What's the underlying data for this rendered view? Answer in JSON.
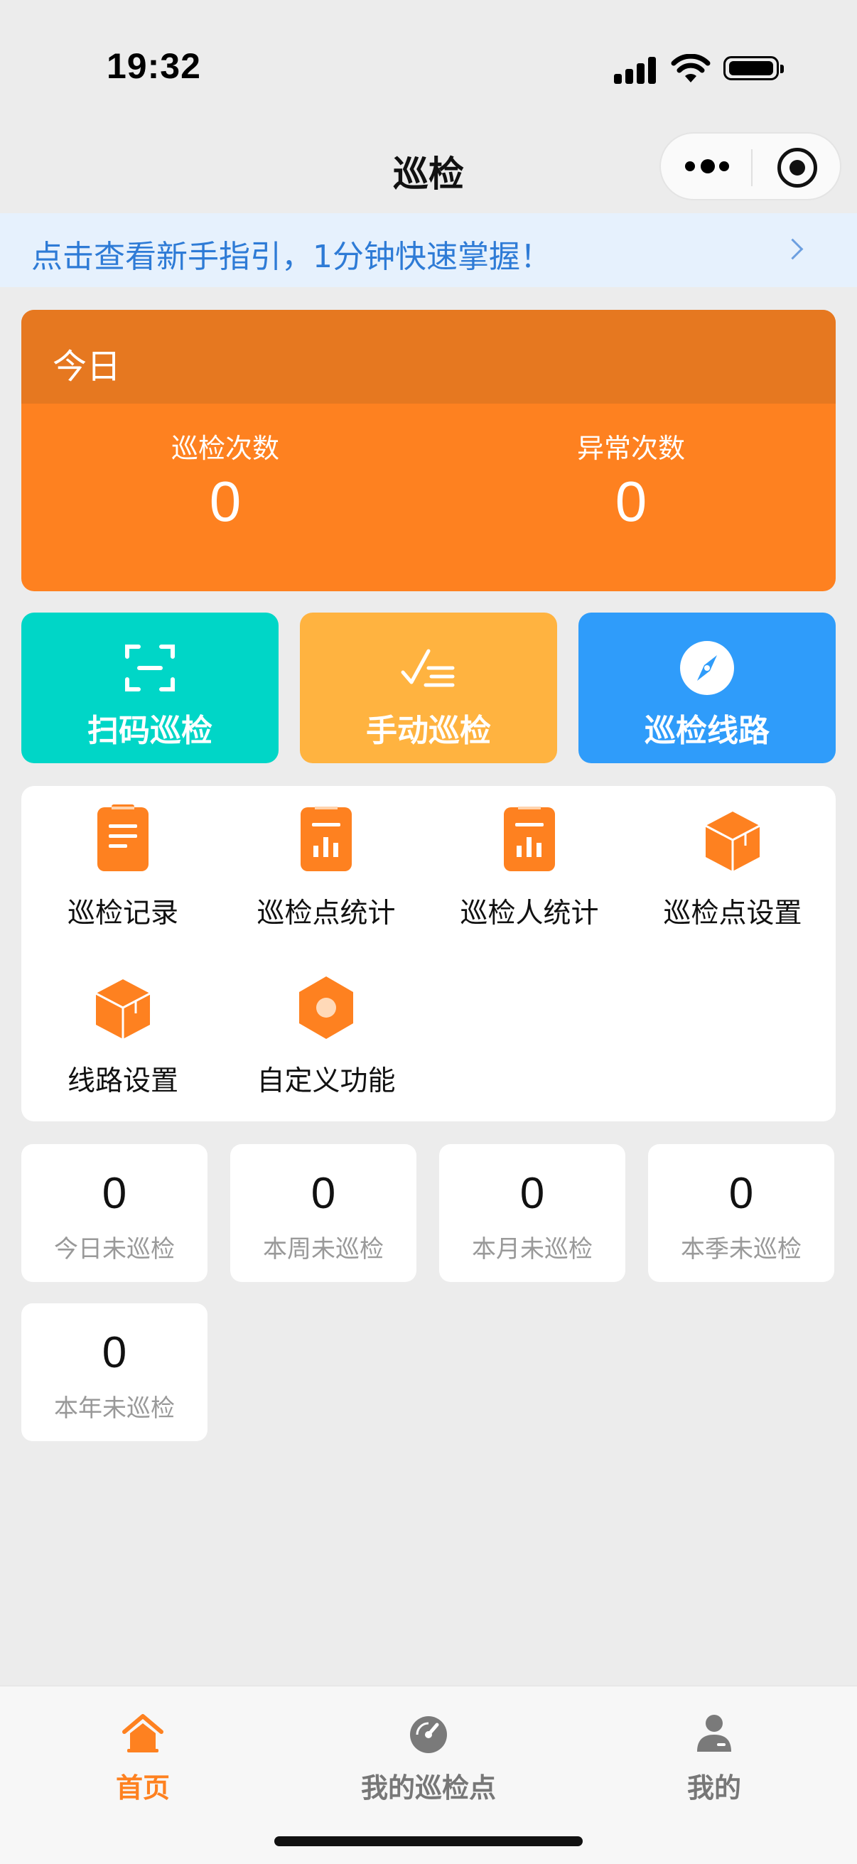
{
  "status_bar": {
    "time": "19:32"
  },
  "nav": {
    "title": "巡检"
  },
  "guide": {
    "text": "点击查看新手指引，1分钟快速掌握！"
  },
  "today": {
    "title": "今日",
    "stats": [
      {
        "label": "巡检次数",
        "value": "0"
      },
      {
        "label": "异常次数",
        "value": "0"
      }
    ]
  },
  "actions": [
    {
      "label": "扫码巡检",
      "icon": "scan-icon",
      "color": "#00d6c7"
    },
    {
      "label": "手动巡检",
      "icon": "checklist-icon",
      "color": "#ffb340"
    },
    {
      "label": "巡检线路",
      "icon": "compass-icon",
      "color": "#2f9cfa"
    }
  ],
  "menu": [
    {
      "label": "巡检记录",
      "icon": "clipboard-list-icon"
    },
    {
      "label": "巡检点统计",
      "icon": "clipboard-chart-icon"
    },
    {
      "label": "巡检人统计",
      "icon": "clipboard-chart-icon"
    },
    {
      "label": "巡检点设置",
      "icon": "box-icon"
    },
    {
      "label": "线路设置",
      "icon": "box-icon"
    },
    {
      "label": "自定义功能",
      "icon": "hexagon-icon"
    }
  ],
  "counters": [
    {
      "value": "0",
      "label": "今日未巡检"
    },
    {
      "value": "0",
      "label": "本周未巡检"
    },
    {
      "value": "0",
      "label": "本月未巡检"
    },
    {
      "value": "0",
      "label": "本季未巡检"
    },
    {
      "value": "0",
      "label": "本年未巡检"
    }
  ],
  "tabs": [
    {
      "label": "首页",
      "icon": "home-icon",
      "active": true
    },
    {
      "label": "我的巡检点",
      "icon": "gauge-icon",
      "active": false
    },
    {
      "label": "我的",
      "icon": "user-icon",
      "active": false
    }
  ],
  "colors": {
    "accent": "#fe8120",
    "tab_active": "#fe8120",
    "tab_inactive": "#777777"
  }
}
